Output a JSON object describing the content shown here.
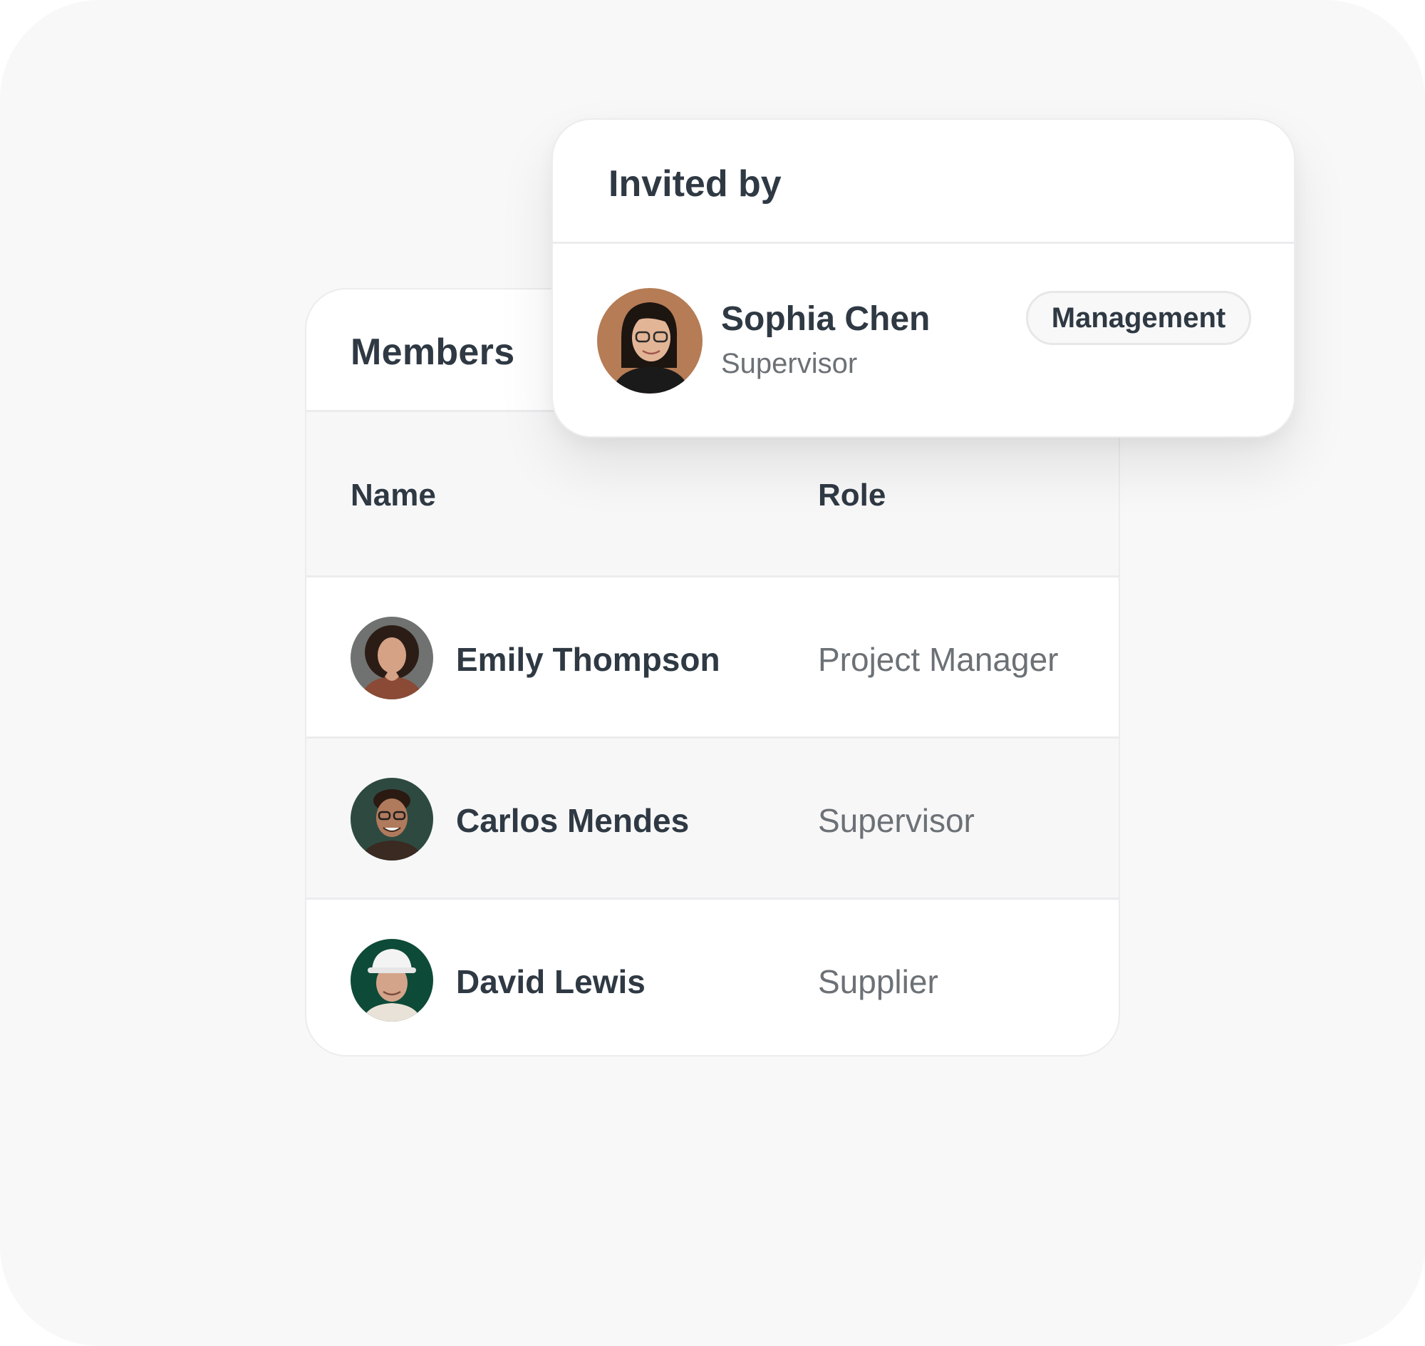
{
  "members_card": {
    "title": "Members",
    "columns": {
      "name": "Name",
      "role": "Role"
    },
    "rows": [
      {
        "name": "Emily Thompson",
        "role": "Project Manager",
        "avatar": "emily-avatar-photo"
      },
      {
        "name": "Carlos Mendes",
        "role": "Supervisor",
        "avatar": "carlos-avatar-photo"
      },
      {
        "name": "David Lewis",
        "role": "Supplier",
        "avatar": "david-avatar-photo"
      }
    ]
  },
  "invited_card": {
    "title": "Invited by",
    "person": {
      "name": "Sophia Chen",
      "role": "Supervisor",
      "badge": "Management",
      "avatar": "sophia-avatar-photo"
    }
  },
  "colors": {
    "background": "#f8f8f9",
    "card": "#ffffff",
    "text_primary": "#2f3943",
    "text_secondary": "#6c7176",
    "border": "#ececee"
  }
}
